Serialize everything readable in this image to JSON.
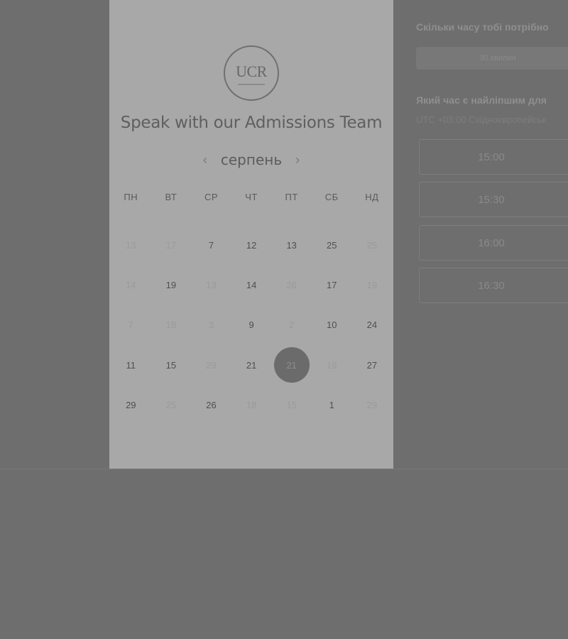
{
  "card": {
    "logo_text": "UCR",
    "title": "Speak with our Admissions Team",
    "month": "серпень",
    "prev_arrow": "‹",
    "next_arrow": "›",
    "weekdays": [
      "ПН",
      "ВТ",
      "СР",
      "ЧТ",
      "ПТ",
      "СБ",
      "НД"
    ],
    "days": [
      {
        "label": "13",
        "muted": true
      },
      {
        "label": "17",
        "muted": true
      },
      {
        "label": "7",
        "muted": false
      },
      {
        "label": "12",
        "muted": false
      },
      {
        "label": "13",
        "muted": false
      },
      {
        "label": "25",
        "muted": false
      },
      {
        "label": "25",
        "muted": true
      },
      {
        "label": "14",
        "muted": true
      },
      {
        "label": "19",
        "muted": false
      },
      {
        "label": "13",
        "muted": true
      },
      {
        "label": "14",
        "muted": false
      },
      {
        "label": "26",
        "muted": true
      },
      {
        "label": "17",
        "muted": false
      },
      {
        "label": "19",
        "muted": true
      },
      {
        "label": "7",
        "muted": true
      },
      {
        "label": "18",
        "muted": true
      },
      {
        "label": "3",
        "muted": true
      },
      {
        "label": "9",
        "muted": false
      },
      {
        "label": "2",
        "muted": true
      },
      {
        "label": "10",
        "muted": false
      },
      {
        "label": "24",
        "muted": false
      },
      {
        "label": "11",
        "muted": false
      },
      {
        "label": "15",
        "muted": false
      },
      {
        "label": "29",
        "muted": true
      },
      {
        "label": "21",
        "muted": false
      },
      {
        "label": "21",
        "muted": false,
        "selected": true
      },
      {
        "label": "19",
        "muted": true
      },
      {
        "label": "27",
        "muted": false
      },
      {
        "label": "29",
        "muted": false
      },
      {
        "label": "25",
        "muted": true
      },
      {
        "label": "26",
        "muted": false
      },
      {
        "label": "18",
        "muted": true
      },
      {
        "label": "15",
        "muted": true
      },
      {
        "label": "1",
        "muted": false
      },
      {
        "label": "29",
        "muted": true
      }
    ]
  },
  "right": {
    "question_duration": "Скільки часу тобі потрібно",
    "duration_value": "30 хвилин",
    "question_time": "Який час є найліпшим для",
    "timezone": "UTC +03:00 Східноєвропейськ",
    "slots": [
      "15:00",
      "15:30",
      "16:00",
      "16:30"
    ]
  }
}
